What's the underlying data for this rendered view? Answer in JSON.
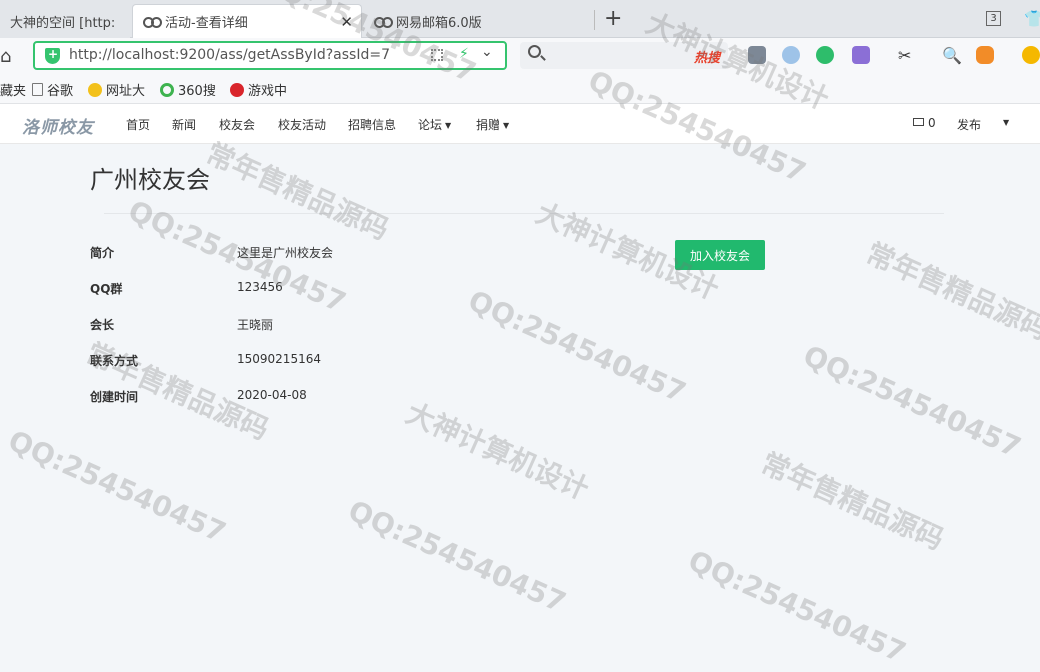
{
  "browser": {
    "tabs": [
      {
        "label": "大神的空间 [http:",
        "active": false
      },
      {
        "label": "活动-查看详细",
        "active": true
      },
      {
        "label": "网易邮箱6.0版",
        "active": false
      }
    ],
    "close_glyph": "✕",
    "new_tab_glyph": "+",
    "tab_count": "3",
    "url": "http://localhost:9200/ass/getAssById?assId=7",
    "search_hot": "热搜"
  },
  "bookmarks": [
    {
      "label": "藏夹"
    },
    {
      "label": "谷歌"
    },
    {
      "label": "网址大"
    },
    {
      "label": "360搜"
    },
    {
      "label": "游戏中"
    }
  ],
  "site": {
    "logo": "洛师校友",
    "nav": [
      {
        "label": "首页"
      },
      {
        "label": "新闻"
      },
      {
        "label": "校友会"
      },
      {
        "label": "校友活动"
      },
      {
        "label": "招聘信息"
      },
      {
        "label": "论坛",
        "dropdown": true
      },
      {
        "label": "捐赠",
        "dropdown": true
      }
    ],
    "mail_count": "0",
    "publish_label": "发布"
  },
  "association": {
    "title": "广州校友会",
    "join_label": "加入校友会",
    "fields": [
      {
        "label": "简介",
        "value": "这里是广州校友会"
      },
      {
        "label": "QQ群",
        "value": "123456"
      },
      {
        "label": "会长",
        "value": "王晓丽"
      },
      {
        "label": "联系方式",
        "value": "15090215164"
      },
      {
        "label": "创建时间",
        "value": "2020-04-08"
      }
    ]
  },
  "watermark": {
    "qq": "QQ:254540457",
    "slogan1": "大神计算机设计",
    "slogan2": "常年售精品源码"
  },
  "colors": {
    "accent_green": "#21b96e",
    "url_border": "#35c46e",
    "hot_red": "#e8412c"
  }
}
